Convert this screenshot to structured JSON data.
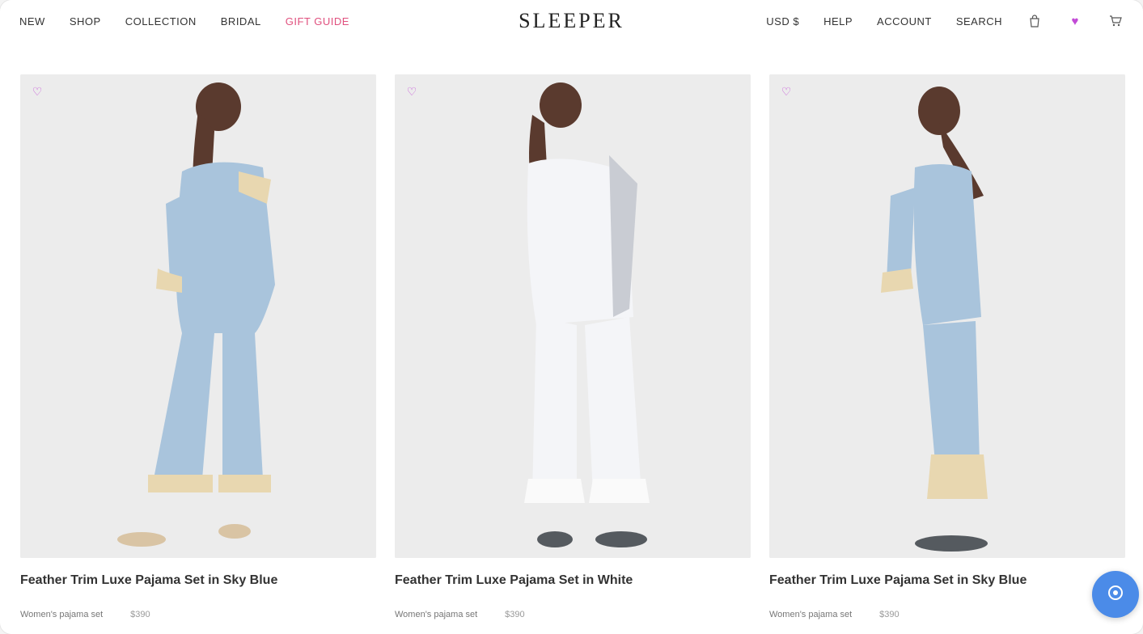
{
  "header": {
    "brand": "SLEEPER",
    "nav_left": [
      "New",
      "Shop",
      "Collection",
      "Bridal",
      "Gift Guide"
    ],
    "nav_right": [
      "USD $",
      "Help",
      "Account",
      "Search"
    ],
    "icons": [
      "bag-icon",
      "wishlist-heart-icon",
      "cart-icon"
    ],
    "accent_color": "#e0507e"
  },
  "products": [
    {
      "title": "Feather Trim Luxe Pajama Set in Sky Blue",
      "meta": "Women's pajama set",
      "price": "$390"
    },
    {
      "title": "Feather Trim Luxe Pajama Set in White",
      "meta": "Women's pajama set",
      "price": "$390"
    },
    {
      "title": "Feather Trim Luxe Pajama Set in Sky Blue",
      "meta": "Women's pajama set",
      "price": "$390"
    }
  ],
  "chat": {
    "icon": "chat-icon",
    "color": "#4b8be8"
  }
}
